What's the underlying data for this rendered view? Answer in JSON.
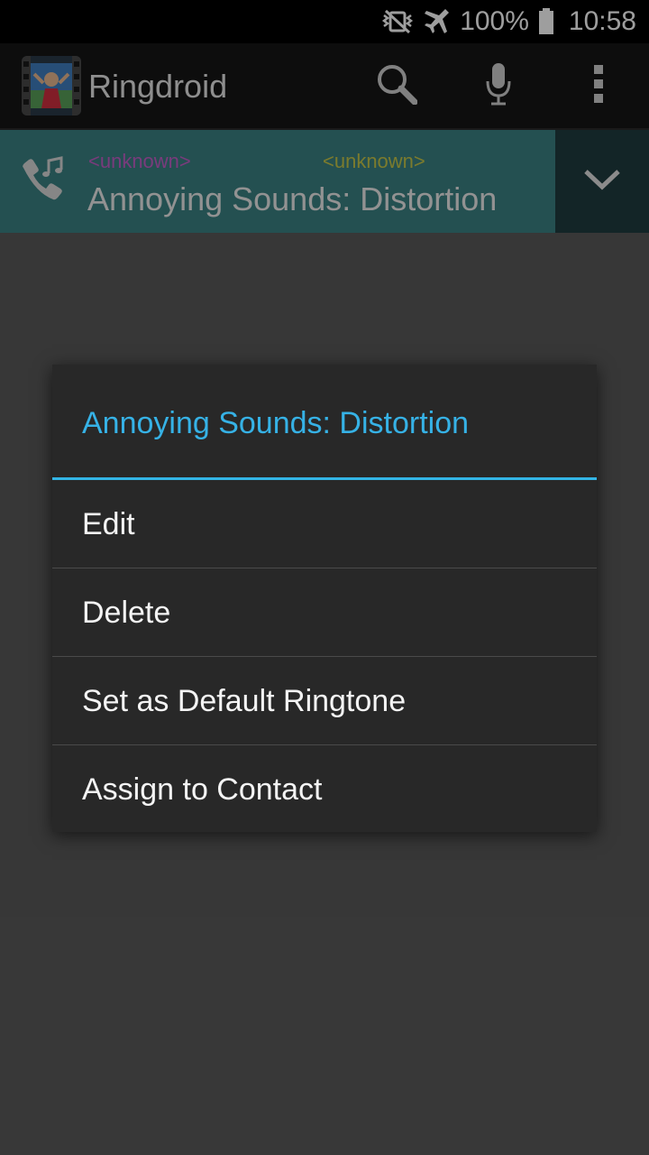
{
  "status_bar": {
    "battery": "100%",
    "time": "10:58",
    "icons": [
      "vibrate-mute-icon",
      "airplane-icon",
      "battery-icon"
    ]
  },
  "action_bar": {
    "title": "Ringdroid",
    "actions": [
      "search-icon",
      "microphone-icon",
      "overflow-menu-icon"
    ]
  },
  "list": {
    "selected_item": {
      "artist": "<unknown>",
      "album": "<unknown>",
      "title": "Annoying Sounds: Distortion",
      "icon": "ringtone-phone-icon"
    }
  },
  "context_menu": {
    "title": "Annoying Sounds: Distortion",
    "items": [
      {
        "label": "Edit"
      },
      {
        "label": "Delete"
      },
      {
        "label": "Set as Default Ringtone"
      },
      {
        "label": "Assign to Contact"
      }
    ]
  },
  "colors": {
    "accent": "#33b5e5",
    "selected_row": "#3b8283",
    "artist_text": "#c45fc8",
    "album_text": "#c7c74a"
  }
}
